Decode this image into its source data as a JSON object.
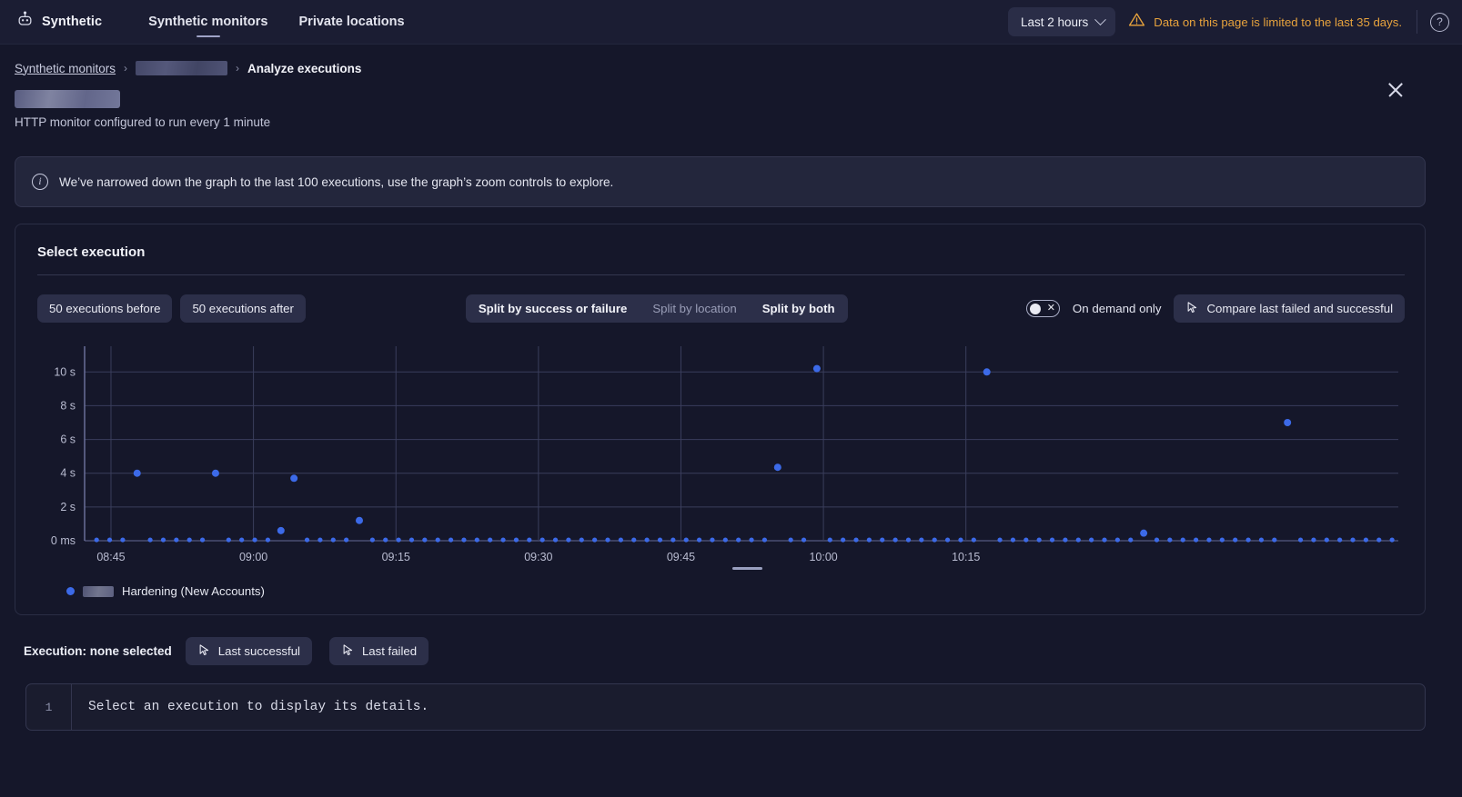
{
  "topnav": {
    "brand_icon": "robot-icon",
    "brand": "Synthetic",
    "items": [
      {
        "label": "Synthetic monitors",
        "active": true
      },
      {
        "label": "Private locations",
        "active": false
      }
    ],
    "timepicker": {
      "label": "Last 2 hours",
      "icon": "chevron-down-icon"
    },
    "warning": {
      "icon": "warning-triangle-icon",
      "text": "Data on this page is limited to the last 35 days.",
      "color": "#e8a33d"
    },
    "help": {
      "icon": "help-circle-icon",
      "glyph": "?"
    }
  },
  "breadcrumb": {
    "root": "Synthetic monitors",
    "separator": "›",
    "redacted": "",
    "current": "Analyze executions"
  },
  "header": {
    "title_redacted": "",
    "subtitle": "HTTP monitor configured to run every 1 minute",
    "close_icon": "close-icon"
  },
  "banner": {
    "icon": "info-circle-icon",
    "text": "We’ve narrowed down the graph to the last 100 executions, use the graph’s zoom controls to explore."
  },
  "card": {
    "title": "Select execution",
    "buttons": {
      "before": "50 executions before",
      "after": "50 executions after"
    },
    "segmented": [
      {
        "label": "Split by success or failure",
        "selected": true
      },
      {
        "label": "Split by location",
        "selected": false
      },
      {
        "label": "Split by both",
        "selected": true
      }
    ],
    "toggle": {
      "label": "On demand only",
      "state": "off",
      "glyph": "✕"
    },
    "compare_button": {
      "label": "Compare last failed and successful",
      "icon": "cursor-pointer-icon"
    }
  },
  "chart_data": {
    "type": "scatter",
    "title": "",
    "xlabel": "",
    "ylabel": "",
    "grid": true,
    "legend_position": "bottom-left",
    "x_ticks": [
      "08:45",
      "09:00",
      "09:15",
      "09:30",
      "09:45",
      "10:00",
      "10:15"
    ],
    "y_ticks": [
      "0 ms",
      "2 s",
      "4 s",
      "6 s",
      "8 s",
      "10 s"
    ],
    "y_tick_values": [
      0,
      2,
      4,
      6,
      8,
      10
    ],
    "ylim": [
      0,
      11.2
    ],
    "xlim_labels": [
      "08:43",
      "10:28"
    ],
    "series": [
      {
        "name": "Hardening (New Accounts)",
        "name_redacted_prefix": "",
        "color": "#3c6ae8",
        "points": [
          [
            0.5,
            0.05
          ],
          [
            1.5,
            0.05
          ],
          [
            2.5,
            0.05
          ],
          [
            3.6,
            4.0
          ],
          [
            4.6,
            0.05
          ],
          [
            5.6,
            0.05
          ],
          [
            6.6,
            0.05
          ],
          [
            7.6,
            0.05
          ],
          [
            8.6,
            0.05
          ],
          [
            9.6,
            4.0
          ],
          [
            10.6,
            0.05
          ],
          [
            11.6,
            0.05
          ],
          [
            12.6,
            0.05
          ],
          [
            13.6,
            0.05
          ],
          [
            14.6,
            0.6
          ],
          [
            15.6,
            3.7
          ],
          [
            16.6,
            0.05
          ],
          [
            17.6,
            0.05
          ],
          [
            18.6,
            0.05
          ],
          [
            19.6,
            0.05
          ],
          [
            20.6,
            1.2
          ],
          [
            21.6,
            0.05
          ],
          [
            22.6,
            0.05
          ],
          [
            23.6,
            0.05
          ],
          [
            24.6,
            0.05
          ],
          [
            25.6,
            0.05
          ],
          [
            26.6,
            0.05
          ],
          [
            27.6,
            0.05
          ],
          [
            28.6,
            0.05
          ],
          [
            29.6,
            0.05
          ],
          [
            30.6,
            0.05
          ],
          [
            31.6,
            0.05
          ],
          [
            32.6,
            0.05
          ],
          [
            33.6,
            0.05
          ],
          [
            34.6,
            0.05
          ],
          [
            35.6,
            0.05
          ],
          [
            36.6,
            0.05
          ],
          [
            37.6,
            0.05
          ],
          [
            38.6,
            0.05
          ],
          [
            39.6,
            0.05
          ],
          [
            40.6,
            0.05
          ],
          [
            41.6,
            0.05
          ],
          [
            42.6,
            0.05
          ],
          [
            43.6,
            0.05
          ],
          [
            44.6,
            0.05
          ],
          [
            45.6,
            0.05
          ],
          [
            46.6,
            0.05
          ],
          [
            47.6,
            0.05
          ],
          [
            48.6,
            0.05
          ],
          [
            49.6,
            0.05
          ],
          [
            50.6,
            0.05
          ],
          [
            51.6,
            0.05
          ],
          [
            52.6,
            4.35
          ],
          [
            53.6,
            0.05
          ],
          [
            54.6,
            0.05
          ],
          [
            55.6,
            10.2
          ],
          [
            56.6,
            0.05
          ],
          [
            57.6,
            0.05
          ],
          [
            58.6,
            0.05
          ],
          [
            59.6,
            0.05
          ],
          [
            60.6,
            0.05
          ],
          [
            61.6,
            0.05
          ],
          [
            62.6,
            0.05
          ],
          [
            63.6,
            0.05
          ],
          [
            64.6,
            0.05
          ],
          [
            65.6,
            0.05
          ],
          [
            66.6,
            0.05
          ],
          [
            67.6,
            0.05
          ],
          [
            68.6,
            10.0
          ],
          [
            69.6,
            0.05
          ],
          [
            70.6,
            0.05
          ],
          [
            71.6,
            0.05
          ],
          [
            72.6,
            0.05
          ],
          [
            73.6,
            0.05
          ],
          [
            74.6,
            0.05
          ],
          [
            75.6,
            0.05
          ],
          [
            76.6,
            0.05
          ],
          [
            77.6,
            0.05
          ],
          [
            78.6,
            0.05
          ],
          [
            79.6,
            0.05
          ],
          [
            80.6,
            0.45
          ],
          [
            81.6,
            0.05
          ],
          [
            82.6,
            0.05
          ],
          [
            83.6,
            0.05
          ],
          [
            84.6,
            0.05
          ],
          [
            85.6,
            0.05
          ],
          [
            86.6,
            0.05
          ],
          [
            87.6,
            0.05
          ],
          [
            88.6,
            0.05
          ],
          [
            89.6,
            0.05
          ],
          [
            90.6,
            0.05
          ],
          [
            91.6,
            7.0
          ],
          [
            92.6,
            0.05
          ],
          [
            93.6,
            0.05
          ],
          [
            94.6,
            0.05
          ],
          [
            95.6,
            0.05
          ],
          [
            96.6,
            0.05
          ],
          [
            97.6,
            0.05
          ],
          [
            98.6,
            0.05
          ],
          [
            99.6,
            0.05
          ]
        ]
      }
    ]
  },
  "footer": {
    "execution_label": "Execution: none selected",
    "last_successful": {
      "label": "Last successful",
      "icon": "cursor-pointer-icon"
    },
    "last_failed": {
      "label": "Last failed",
      "icon": "cursor-pointer-icon"
    },
    "editor": {
      "line_number": "1",
      "content": "Select an execution to display its details."
    }
  }
}
